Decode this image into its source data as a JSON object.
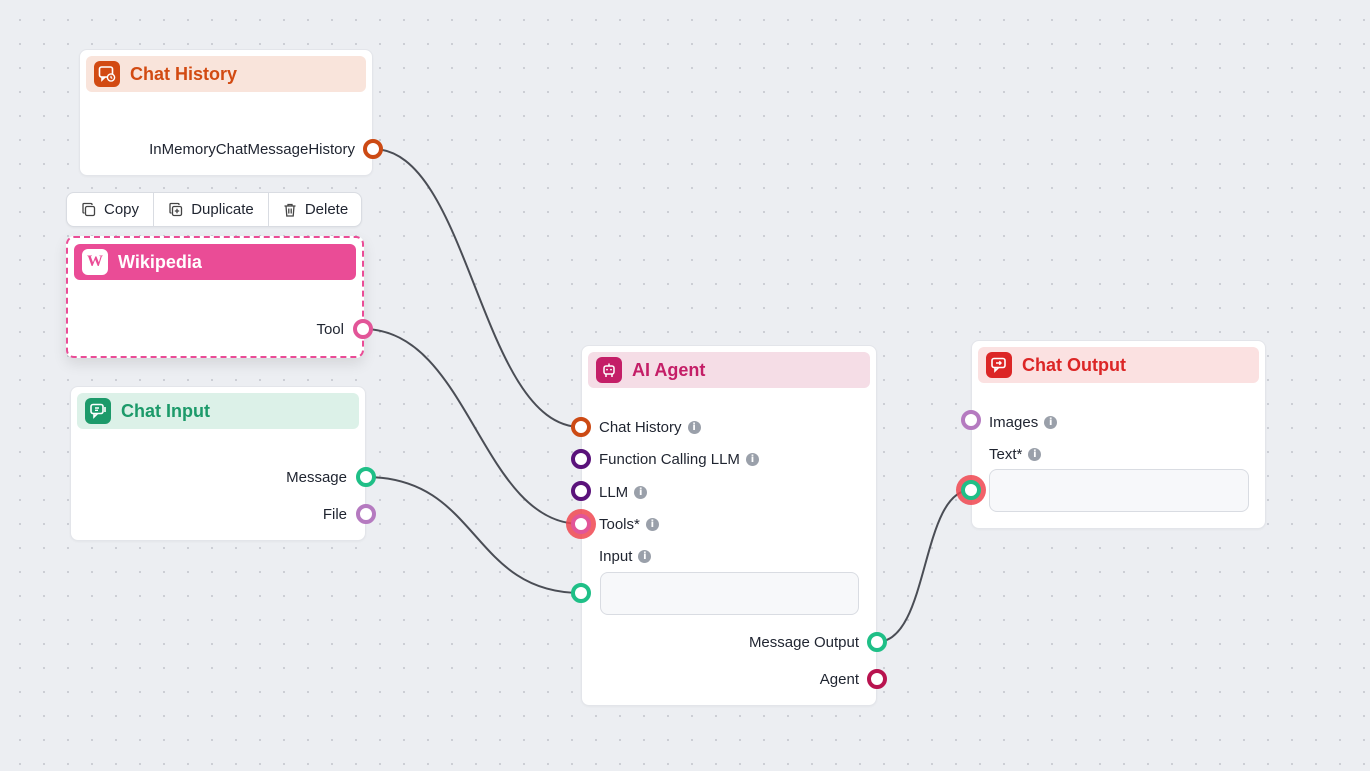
{
  "toolbar": {
    "copy_label": "Copy",
    "duplicate_label": "Duplicate",
    "delete_label": "Delete"
  },
  "nodes": {
    "chat_history": {
      "title": "Chat History",
      "outputs": [
        "InMemoryChatMessageHistory"
      ],
      "accent": "#d24a12",
      "header_bg": "#f9e4db"
    },
    "wikipedia": {
      "title": "Wikipedia",
      "outputs": [
        "Tool"
      ],
      "accent": "#ea4c96",
      "header_bg": "#ea4c96",
      "icon_letter": "W"
    },
    "chat_input": {
      "title": "Chat Input",
      "outputs": [
        "Message",
        "File"
      ],
      "accent": "#1c9a6a",
      "header_bg": "#dcf1e8"
    },
    "ai_agent": {
      "title": "AI Agent",
      "inputs": [
        "Chat History",
        "Function Calling LLM",
        "LLM",
        "Tools*",
        "Input"
      ],
      "outputs": [
        "Message Output",
        "Agent"
      ],
      "accent": "#c41e67",
      "header_bg": "#f5dde6"
    },
    "chat_output": {
      "title": "Chat Output",
      "inputs": [
        "Images",
        "Text*"
      ],
      "accent": "#dc2626",
      "header_bg": "#fbe1e1"
    }
  },
  "icons": {
    "chat_history": "message-clock-icon",
    "wikipedia": "wikipedia-icon",
    "chat_input": "message-input-icon",
    "ai_agent": "bot-icon",
    "chat_output": "message-output-icon",
    "info": "info-icon",
    "copy": "copy-icon",
    "duplicate": "duplicate-icon",
    "delete": "trash-icon"
  },
  "handle_colors": {
    "memory": "#cc4a14",
    "tool": "#e25598",
    "message": "#1fbf87",
    "file": "#b57ac0",
    "llm": "#5a127a",
    "agent": "#b8134f"
  }
}
